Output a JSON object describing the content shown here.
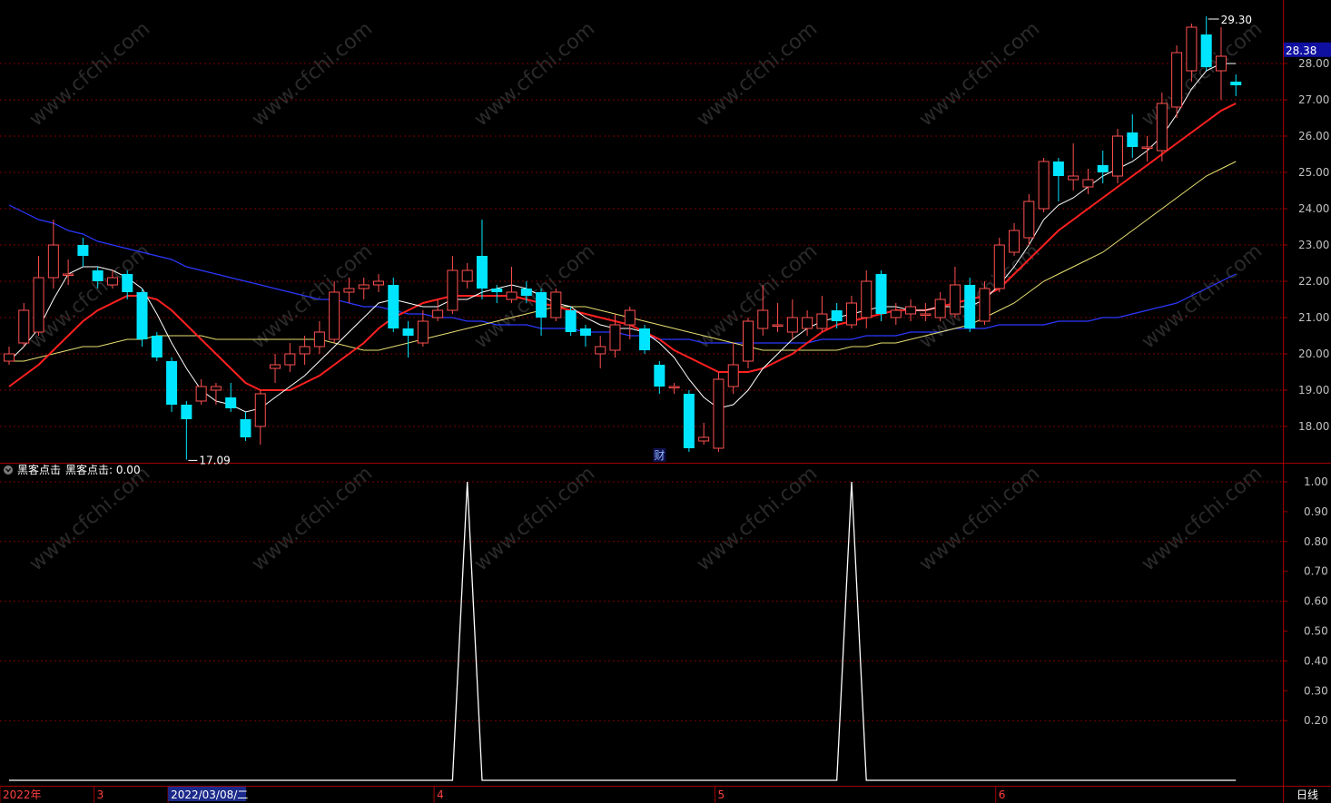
{
  "colors": {
    "background": "#000000",
    "frame": "#a00000",
    "grid": "#7a0000",
    "axis_text": "#c0c0c0",
    "bull": "#ff5050",
    "bear": "#00e5ff",
    "ma5": "#ffffff",
    "ma10": "#ff2020",
    "ma20": "#e8e070",
    "ma60": "#2b38ff",
    "current_price_bg": "#1010a0",
    "indicator_line": "#ffffff",
    "watermark": "#2a2a2a"
  },
  "watermark_text": "www.cfchi.com",
  "chart_data": [
    {
      "type": "candlestick",
      "ylim": [
        17.0,
        29.6
      ],
      "y_ticks": [
        "18.00",
        "19.00",
        "20.00",
        "21.00",
        "22.00",
        "23.00",
        "24.00",
        "25.00",
        "26.00",
        "27.00",
        "28.00"
      ],
      "current_price_label": "28.38",
      "current_price": 28.38,
      "max_label": "29.30",
      "min_label": "17.09",
      "event_marker": "财",
      "event_marker_index": 44,
      "candles": [
        {
          "o": 19.8,
          "c": 20.0,
          "h": 20.2,
          "l": 19.7
        },
        {
          "o": 20.3,
          "c": 21.2,
          "h": 21.4,
          "l": 20.2
        },
        {
          "o": 20.6,
          "c": 22.1,
          "h": 22.7,
          "l": 20.5
        },
        {
          "o": 22.1,
          "c": 23.0,
          "h": 23.7,
          "l": 21.8
        },
        {
          "o": 22.2,
          "c": 22.2,
          "h": 22.6,
          "l": 21.9
        },
        {
          "o": 23.0,
          "c": 22.7,
          "h": 23.2,
          "l": 22.4
        },
        {
          "o": 22.3,
          "c": 22.0,
          "h": 22.4,
          "l": 21.8
        },
        {
          "o": 21.9,
          "c": 22.1,
          "h": 22.3,
          "l": 21.8
        },
        {
          "o": 22.2,
          "c": 21.7,
          "h": 22.3,
          "l": 21.5
        },
        {
          "o": 21.7,
          "c": 20.4,
          "h": 21.8,
          "l": 20.2
        },
        {
          "o": 20.5,
          "c": 19.9,
          "h": 20.6,
          "l": 19.8
        },
        {
          "o": 19.8,
          "c": 18.6,
          "h": 19.9,
          "l": 18.4
        },
        {
          "o": 18.6,
          "c": 18.2,
          "h": 18.7,
          "l": 17.09
        },
        {
          "o": 18.7,
          "c": 19.1,
          "h": 19.3,
          "l": 18.6
        },
        {
          "o": 19.0,
          "c": 19.1,
          "h": 19.2,
          "l": 18.6
        },
        {
          "o": 18.8,
          "c": 18.5,
          "h": 19.2,
          "l": 18.4
        },
        {
          "o": 18.2,
          "c": 17.7,
          "h": 18.4,
          "l": 17.6
        },
        {
          "o": 18.0,
          "c": 18.9,
          "h": 19.0,
          "l": 17.5
        },
        {
          "o": 19.6,
          "c": 19.7,
          "h": 20.0,
          "l": 19.2
        },
        {
          "o": 19.7,
          "c": 20.0,
          "h": 20.3,
          "l": 19.5
        },
        {
          "o": 20.0,
          "c": 20.2,
          "h": 20.5,
          "l": 19.7
        },
        {
          "o": 20.2,
          "c": 20.6,
          "h": 20.9,
          "l": 20.0
        },
        {
          "o": 20.4,
          "c": 21.7,
          "h": 22.0,
          "l": 20.3
        },
        {
          "o": 21.7,
          "c": 21.8,
          "h": 22.1,
          "l": 21.4
        },
        {
          "o": 21.8,
          "c": 21.9,
          "h": 22.1,
          "l": 21.5
        },
        {
          "o": 21.9,
          "c": 22.0,
          "h": 22.2,
          "l": 21.7
        },
        {
          "o": 21.9,
          "c": 20.7,
          "h": 22.1,
          "l": 20.6
        },
        {
          "o": 20.7,
          "c": 20.5,
          "h": 20.9,
          "l": 19.9
        },
        {
          "o": 20.3,
          "c": 20.9,
          "h": 21.2,
          "l": 20.2
        },
        {
          "o": 21.0,
          "c": 21.2,
          "h": 21.5,
          "l": 20.9
        },
        {
          "o": 21.2,
          "c": 22.3,
          "h": 22.7,
          "l": 21.1
        },
        {
          "o": 22.0,
          "c": 22.3,
          "h": 22.5,
          "l": 21.8
        },
        {
          "o": 22.7,
          "c": 21.8,
          "h": 23.7,
          "l": 21.5
        },
        {
          "o": 21.8,
          "c": 21.7,
          "h": 21.9,
          "l": 21.4
        },
        {
          "o": 21.5,
          "c": 21.7,
          "h": 22.4,
          "l": 21.4
        },
        {
          "o": 21.8,
          "c": 21.6,
          "h": 22.0,
          "l": 21.4
        },
        {
          "o": 21.7,
          "c": 21.0,
          "h": 21.8,
          "l": 20.5
        },
        {
          "o": 21.0,
          "c": 21.7,
          "h": 21.8,
          "l": 20.9
        },
        {
          "o": 21.2,
          "c": 20.6,
          "h": 21.3,
          "l": 20.5
        },
        {
          "o": 20.7,
          "c": 20.5,
          "h": 20.8,
          "l": 20.2
        },
        {
          "o": 20.0,
          "c": 20.2,
          "h": 20.5,
          "l": 19.6
        },
        {
          "o": 20.1,
          "c": 20.8,
          "h": 21.1,
          "l": 19.9
        },
        {
          "o": 20.8,
          "c": 21.2,
          "h": 21.3,
          "l": 20.4
        },
        {
          "o": 20.7,
          "c": 20.1,
          "h": 20.8,
          "l": 20.0
        },
        {
          "o": 19.7,
          "c": 19.1,
          "h": 19.8,
          "l": 18.9
        },
        {
          "o": 19.1,
          "c": 19.1,
          "h": 19.2,
          "l": 18.9
        },
        {
          "o": 18.9,
          "c": 17.4,
          "h": 19.0,
          "l": 17.3
        },
        {
          "o": 17.6,
          "c": 17.7,
          "h": 18.1,
          "l": 17.5
        },
        {
          "o": 17.4,
          "c": 19.3,
          "h": 19.5,
          "l": 17.3
        },
        {
          "o": 19.1,
          "c": 19.7,
          "h": 20.3,
          "l": 18.9
        },
        {
          "o": 19.8,
          "c": 20.9,
          "h": 21.0,
          "l": 19.6
        },
        {
          "o": 20.7,
          "c": 21.2,
          "h": 21.9,
          "l": 20.5
        },
        {
          "o": 20.8,
          "c": 20.8,
          "h": 21.4,
          "l": 20.6
        },
        {
          "o": 20.6,
          "c": 21.0,
          "h": 21.5,
          "l": 20.4
        },
        {
          "o": 20.7,
          "c": 21.0,
          "h": 21.2,
          "l": 20.5
        },
        {
          "o": 20.7,
          "c": 21.1,
          "h": 21.6,
          "l": 20.6
        },
        {
          "o": 21.2,
          "c": 20.9,
          "h": 21.4,
          "l": 20.7
        },
        {
          "o": 20.8,
          "c": 21.4,
          "h": 21.6,
          "l": 20.7
        },
        {
          "o": 21.0,
          "c": 22.0,
          "h": 22.3,
          "l": 20.7
        },
        {
          "o": 22.2,
          "c": 21.1,
          "h": 22.3,
          "l": 20.9
        },
        {
          "o": 21.0,
          "c": 21.2,
          "h": 21.4,
          "l": 20.8
        },
        {
          "o": 21.1,
          "c": 21.3,
          "h": 21.5,
          "l": 20.9
        },
        {
          "o": 21.1,
          "c": 21.1,
          "h": 21.4,
          "l": 20.9
        },
        {
          "o": 21.0,
          "c": 21.5,
          "h": 21.7,
          "l": 20.9
        },
        {
          "o": 21.1,
          "c": 21.9,
          "h": 22.4,
          "l": 21.0
        },
        {
          "o": 21.9,
          "c": 20.7,
          "h": 22.1,
          "l": 20.6
        },
        {
          "o": 20.9,
          "c": 21.8,
          "h": 22.0,
          "l": 20.8
        },
        {
          "o": 21.8,
          "c": 23.0,
          "h": 23.2,
          "l": 21.7
        },
        {
          "o": 22.8,
          "c": 23.4,
          "h": 23.6,
          "l": 22.7
        },
        {
          "o": 23.2,
          "c": 24.2,
          "h": 24.4,
          "l": 23.0
        },
        {
          "o": 24.0,
          "c": 25.3,
          "h": 25.4,
          "l": 23.9
        },
        {
          "o": 25.3,
          "c": 24.9,
          "h": 25.4,
          "l": 24.2
        },
        {
          "o": 24.8,
          "c": 24.9,
          "h": 25.8,
          "l": 24.5
        },
        {
          "o": 24.6,
          "c": 24.8,
          "h": 25.1,
          "l": 24.4
        },
        {
          "o": 25.2,
          "c": 25.0,
          "h": 25.6,
          "l": 24.7
        },
        {
          "o": 24.9,
          "c": 26.0,
          "h": 26.2,
          "l": 24.7
        },
        {
          "o": 26.1,
          "c": 25.7,
          "h": 26.6,
          "l": 25.4
        },
        {
          "o": 25.7,
          "c": 25.7,
          "h": 26.0,
          "l": 25.3
        },
        {
          "o": 25.6,
          "c": 26.9,
          "h": 27.2,
          "l": 25.3
        },
        {
          "o": 26.8,
          "c": 28.3,
          "h": 28.5,
          "l": 26.5
        },
        {
          "o": 27.8,
          "c": 29.0,
          "h": 29.1,
          "l": 27.5
        },
        {
          "o": 28.8,
          "c": 27.9,
          "h": 29.3,
          "l": 27.8
        },
        {
          "o": 27.8,
          "c": 28.2,
          "h": 29.0,
          "l": 27.0
        },
        {
          "o": 27.5,
          "c": 27.4,
          "h": 27.7,
          "l": 27.1
        }
      ],
      "ma5": [
        19.8,
        20.2,
        20.7,
        21.5,
        22.2,
        22.4,
        22.4,
        22.3,
        22.1,
        21.8,
        21.1,
        20.3,
        19.6,
        19.0,
        18.7,
        18.6,
        18.4,
        18.5,
        18.8,
        19.1,
        19.4,
        19.8,
        20.2,
        20.6,
        21.0,
        21.4,
        21.5,
        21.4,
        21.3,
        21.3,
        21.5,
        21.5,
        21.7,
        21.8,
        21.9,
        21.8,
        21.6,
        21.4,
        21.3,
        21.0,
        20.8,
        20.7,
        20.7,
        20.6,
        20.3,
        19.9,
        19.3,
        18.8,
        18.5,
        18.6,
        19.0,
        19.6,
        20.0,
        20.4,
        20.7,
        20.9,
        21.0,
        21.1,
        21.2,
        21.3,
        21.3,
        21.2,
        21.2,
        21.3,
        21.3,
        21.3,
        21.5,
        21.9,
        22.4,
        23.0,
        23.7,
        24.1,
        24.3,
        24.6,
        24.9,
        25.1,
        25.3,
        25.6,
        26.0,
        26.6,
        27.3,
        27.8,
        28.0,
        28.0
      ],
      "ma10": [
        19.1,
        19.4,
        19.7,
        20.1,
        20.5,
        20.9,
        21.2,
        21.4,
        21.6,
        21.6,
        21.5,
        21.2,
        20.8,
        20.4,
        20.0,
        19.6,
        19.2,
        19.0,
        19.0,
        19.0,
        19.2,
        19.4,
        19.7,
        20.0,
        20.3,
        20.7,
        21.0,
        21.2,
        21.4,
        21.5,
        21.6,
        21.6,
        21.6,
        21.6,
        21.6,
        21.5,
        21.4,
        21.3,
        21.2,
        21.1,
        21.0,
        20.9,
        20.8,
        20.6,
        20.4,
        20.1,
        19.9,
        19.7,
        19.5,
        19.5,
        19.5,
        19.6,
        19.8,
        20.0,
        20.3,
        20.6,
        20.8,
        20.9,
        21.0,
        21.1,
        21.2,
        21.2,
        21.2,
        21.3,
        21.4,
        21.5,
        21.6,
        21.8,
        22.2,
        22.6,
        23.0,
        23.4,
        23.7,
        24.0,
        24.3,
        24.6,
        24.9,
        25.2,
        25.5,
        25.8,
        26.1,
        26.4,
        26.7,
        26.9
      ],
      "ma20": [
        19.8,
        19.8,
        19.9,
        20.0,
        20.1,
        20.2,
        20.2,
        20.3,
        20.4,
        20.4,
        20.5,
        20.5,
        20.5,
        20.5,
        20.4,
        20.4,
        20.4,
        20.4,
        20.4,
        20.4,
        20.4,
        20.4,
        20.3,
        20.2,
        20.1,
        20.1,
        20.2,
        20.3,
        20.4,
        20.5,
        20.6,
        20.7,
        20.8,
        20.9,
        21.0,
        21.1,
        21.2,
        21.3,
        21.3,
        21.3,
        21.2,
        21.1,
        21.0,
        20.9,
        20.8,
        20.7,
        20.6,
        20.5,
        20.4,
        20.3,
        20.2,
        20.1,
        20.1,
        20.1,
        20.1,
        20.1,
        20.1,
        20.2,
        20.2,
        20.3,
        20.3,
        20.4,
        20.5,
        20.6,
        20.7,
        20.8,
        21.0,
        21.2,
        21.4,
        21.7,
        22.0,
        22.2,
        22.4,
        22.6,
        22.8,
        23.1,
        23.4,
        23.7,
        24.0,
        24.3,
        24.6,
        24.9,
        25.1,
        25.3
      ],
      "ma60": [
        24.1,
        23.9,
        23.7,
        23.6,
        23.4,
        23.3,
        23.1,
        23.0,
        22.9,
        22.8,
        22.7,
        22.6,
        22.4,
        22.3,
        22.2,
        22.1,
        22.0,
        21.9,
        21.8,
        21.7,
        21.6,
        21.5,
        21.5,
        21.4,
        21.3,
        21.3,
        21.2,
        21.1,
        21.1,
        21.0,
        21.0,
        20.9,
        20.9,
        20.8,
        20.8,
        20.8,
        20.7,
        20.7,
        20.7,
        20.6,
        20.6,
        20.6,
        20.5,
        20.5,
        20.4,
        20.4,
        20.4,
        20.3,
        20.3,
        20.3,
        20.3,
        20.3,
        20.3,
        20.3,
        20.3,
        20.4,
        20.4,
        20.4,
        20.5,
        20.5,
        20.5,
        20.6,
        20.6,
        20.6,
        20.7,
        20.7,
        20.7,
        20.8,
        20.8,
        20.8,
        20.8,
        20.9,
        20.9,
        20.9,
        21.0,
        21.0,
        21.1,
        21.2,
        21.3,
        21.4,
        21.6,
        21.8,
        22.0,
        22.2
      ]
    },
    {
      "type": "line",
      "title_icon": "chevron-down-icon",
      "name": "黑客点击",
      "value_label": "黑客点击: 0.00",
      "ylim": [
        0,
        1.0
      ],
      "y_ticks": [
        "0.20",
        "0.30",
        "0.40",
        "0.50",
        "0.60",
        "0.70",
        "0.80",
        "0.90",
        "1.00"
      ],
      "spike_indices": [
        31,
        57
      ],
      "x_labels": [
        {
          "text": "2022年",
          "index": 0
        },
        {
          "text": "3",
          "index": 6
        },
        {
          "text": "2022/03/08/二",
          "index": 11
        },
        {
          "text": "4",
          "index": 29
        },
        {
          "text": "5",
          "index": 48
        },
        {
          "text": "6",
          "index": 67
        }
      ],
      "period_label": "日线"
    }
  ]
}
